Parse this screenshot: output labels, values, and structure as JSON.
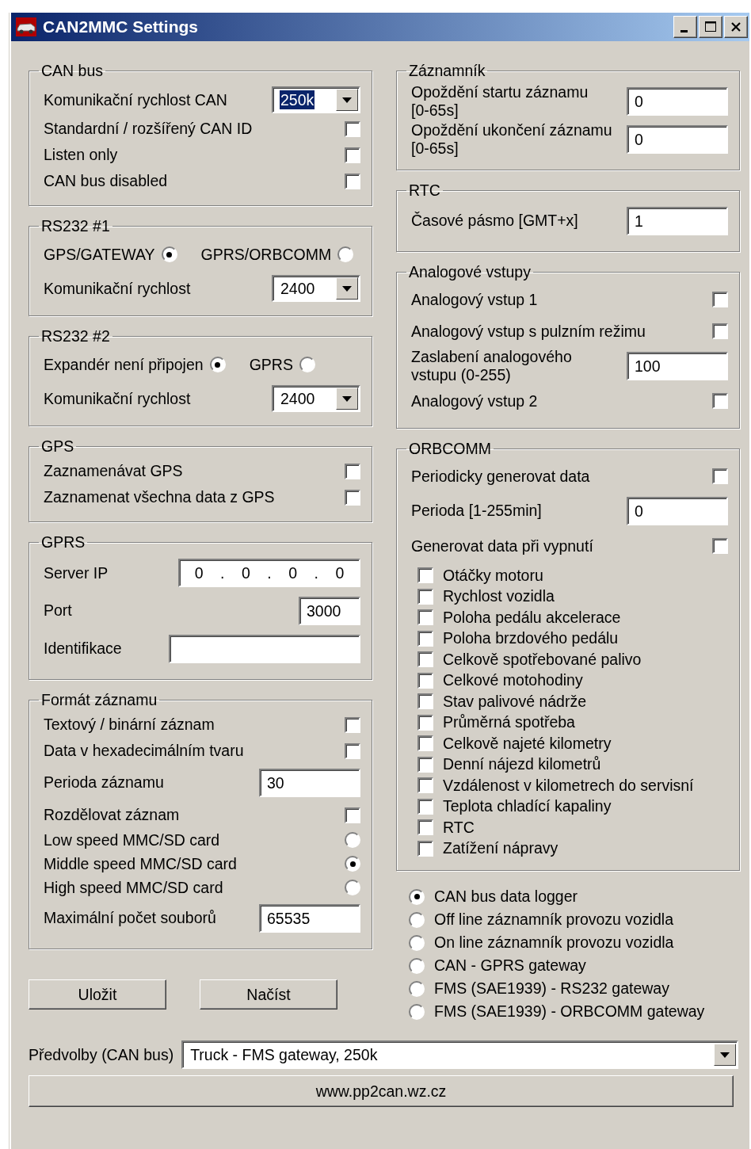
{
  "window": {
    "title": "CAN2MMC Settings"
  },
  "left_groups": [
    {
      "title": "CAN bus",
      "rows": [
        {
          "kind": "combo",
          "label": "Komunikační rychlost CAN",
          "value": "250k",
          "highlighted": true
        },
        {
          "kind": "check",
          "label": "Standardní / rozšířený CAN ID",
          "checked": false
        },
        {
          "kind": "check",
          "label": "Listen only",
          "checked": false
        },
        {
          "kind": "check",
          "label": "CAN bus disabled",
          "checked": false
        }
      ]
    },
    {
      "title": "RS232 #1",
      "rows": [
        {
          "kind": "radio_pair",
          "options": [
            {
              "label": "GPS/GATEWAY",
              "selected": true
            },
            {
              "label": "GPRS/ORBCOMM",
              "selected": false
            }
          ]
        },
        {
          "kind": "combo",
          "label": "Komunikační rychlost",
          "value": "2400",
          "highlighted": false
        }
      ]
    },
    {
      "title": "RS232 #2",
      "rows": [
        {
          "kind": "radio_pair",
          "options": [
            {
              "label": "Expandér není připojen",
              "selected": true
            },
            {
              "label": "GPRS",
              "selected": false
            }
          ]
        },
        {
          "kind": "combo",
          "label": "Komunikační rychlost",
          "value": "2400",
          "highlighted": false
        }
      ]
    },
    {
      "title": "GPS",
      "rows": [
        {
          "kind": "check",
          "label": "Zaznamenávat GPS",
          "checked": false
        },
        {
          "kind": "check",
          "label": "Zaznamenat všechna data z GPS",
          "checked": false
        }
      ]
    },
    {
      "title": "GPRS",
      "rows": [
        {
          "kind": "ip",
          "label": "Server IP",
          "octets": [
            "0",
            "0",
            "0",
            "0"
          ],
          "separator": "."
        },
        {
          "kind": "short_text",
          "label": "Port",
          "value": "3000"
        },
        {
          "kind": "wide_text",
          "label": "Identifikace"
        }
      ]
    },
    {
      "title": "Formát záznamu",
      "rows": [
        {
          "kind": "check",
          "label": "Textový / binární záznam",
          "checked": false
        },
        {
          "kind": "check",
          "label": "Data v hexadecimálním tvaru",
          "checked": false
        },
        {
          "kind": "text",
          "label": "Perioda záznamu",
          "value": "30"
        },
        {
          "kind": "check",
          "label": "Rozdělovat záznam",
          "checked": false
        },
        {
          "kind": "radio",
          "label": "Low speed MMC/SD card",
          "selected": false
        },
        {
          "kind": "radio",
          "label": "Middle speed MMC/SD card",
          "selected": true
        },
        {
          "kind": "radio",
          "label": "High speed MMC/SD card",
          "selected": false
        },
        {
          "kind": "text",
          "label": "Maximální počet souborů",
          "value": "65535"
        }
      ]
    }
  ],
  "right_groups": [
    {
      "title": "Záznamník",
      "rows": [
        {
          "kind": "text",
          "label": "Opoždění startu záznamu\n[0-65s]",
          "value": "0"
        },
        {
          "kind": "text",
          "label": "Opoždění ukončení záznamu\n[0-65s]",
          "value": "0"
        }
      ]
    },
    {
      "title": "RTC",
      "rows": [
        {
          "kind": "text",
          "label": "Časové pásmo [GMT+x]",
          "value": "1"
        }
      ]
    },
    {
      "title": "Analogové vstupy",
      "rows": [
        {
          "kind": "check",
          "label": "Analogový vstup 1",
          "checked": false
        },
        {
          "kind": "check",
          "label": "Analogový vstup s pulzním režimu",
          "checked": false
        },
        {
          "kind": "text",
          "label": "Zaslabení analogového\nvstupu (0-255)",
          "value": "100"
        },
        {
          "kind": "check",
          "label": "Analogový vstup 2",
          "checked": false
        }
      ]
    },
    {
      "title": "ORBCOMM",
      "rows": [
        {
          "kind": "check",
          "label": "Periodicky generovat data",
          "checked": false
        },
        {
          "kind": "text",
          "label": "Perioda [1-255min]",
          "value": "0"
        },
        {
          "kind": "check",
          "label": "Generovat data při vypnutí",
          "checked": false
        },
        {
          "kind": "left_check",
          "label": "Otáčky motoru",
          "checked": false
        },
        {
          "kind": "left_check",
          "label": "Rychlost vozidla",
          "checked": false
        },
        {
          "kind": "left_check",
          "label": "Poloha pedálu akcelerace",
          "checked": false
        },
        {
          "kind": "left_check",
          "label": "Poloha brzdového pedálu",
          "checked": false
        },
        {
          "kind": "left_check",
          "label": "Celkově spotřebované palivo",
          "checked": false
        },
        {
          "kind": "left_check",
          "label": "Celkové motohodiny",
          "checked": false
        },
        {
          "kind": "left_check",
          "label": "Stav palivové nádrže",
          "checked": false
        },
        {
          "kind": "left_check",
          "label": "Průměrná spotřeba",
          "checked": false
        },
        {
          "kind": "left_check",
          "label": "Celkově najeté kilometry",
          "checked": false
        },
        {
          "kind": "left_check",
          "label": "Denní nájezd kilometrů",
          "checked": false
        },
        {
          "kind": "left_check",
          "label": "Vzdálenost v kilometrech do servisní",
          "checked": false
        },
        {
          "kind": "left_check",
          "label": "Teplota chladící kapaliny",
          "checked": false
        },
        {
          "kind": "left_check",
          "label": "RTC",
          "checked": false
        },
        {
          "kind": "left_check",
          "label": "Zatížení nápravy",
          "checked": false
        }
      ]
    }
  ],
  "modes": [
    {
      "label": "CAN bus data logger",
      "selected": true
    },
    {
      "label": "Off line záznamník provozu vozidla",
      "selected": false
    },
    {
      "label": "On line záznamník provozu vozidla",
      "selected": false
    },
    {
      "label": "CAN - GPRS gateway",
      "selected": false
    },
    {
      "label": "FMS (SAE1939) - RS232 gateway",
      "selected": false
    },
    {
      "label": "FMS (SAE1939) - ORBCOMM gateway",
      "selected": false
    }
  ],
  "buttons": [
    "Uložit",
    "Načíst"
  ],
  "presets": {
    "label": "Předvolby (CAN bus)",
    "value": "Truck - FMS gateway, 250k"
  },
  "link_button": "www.pp2can.wz.cz"
}
